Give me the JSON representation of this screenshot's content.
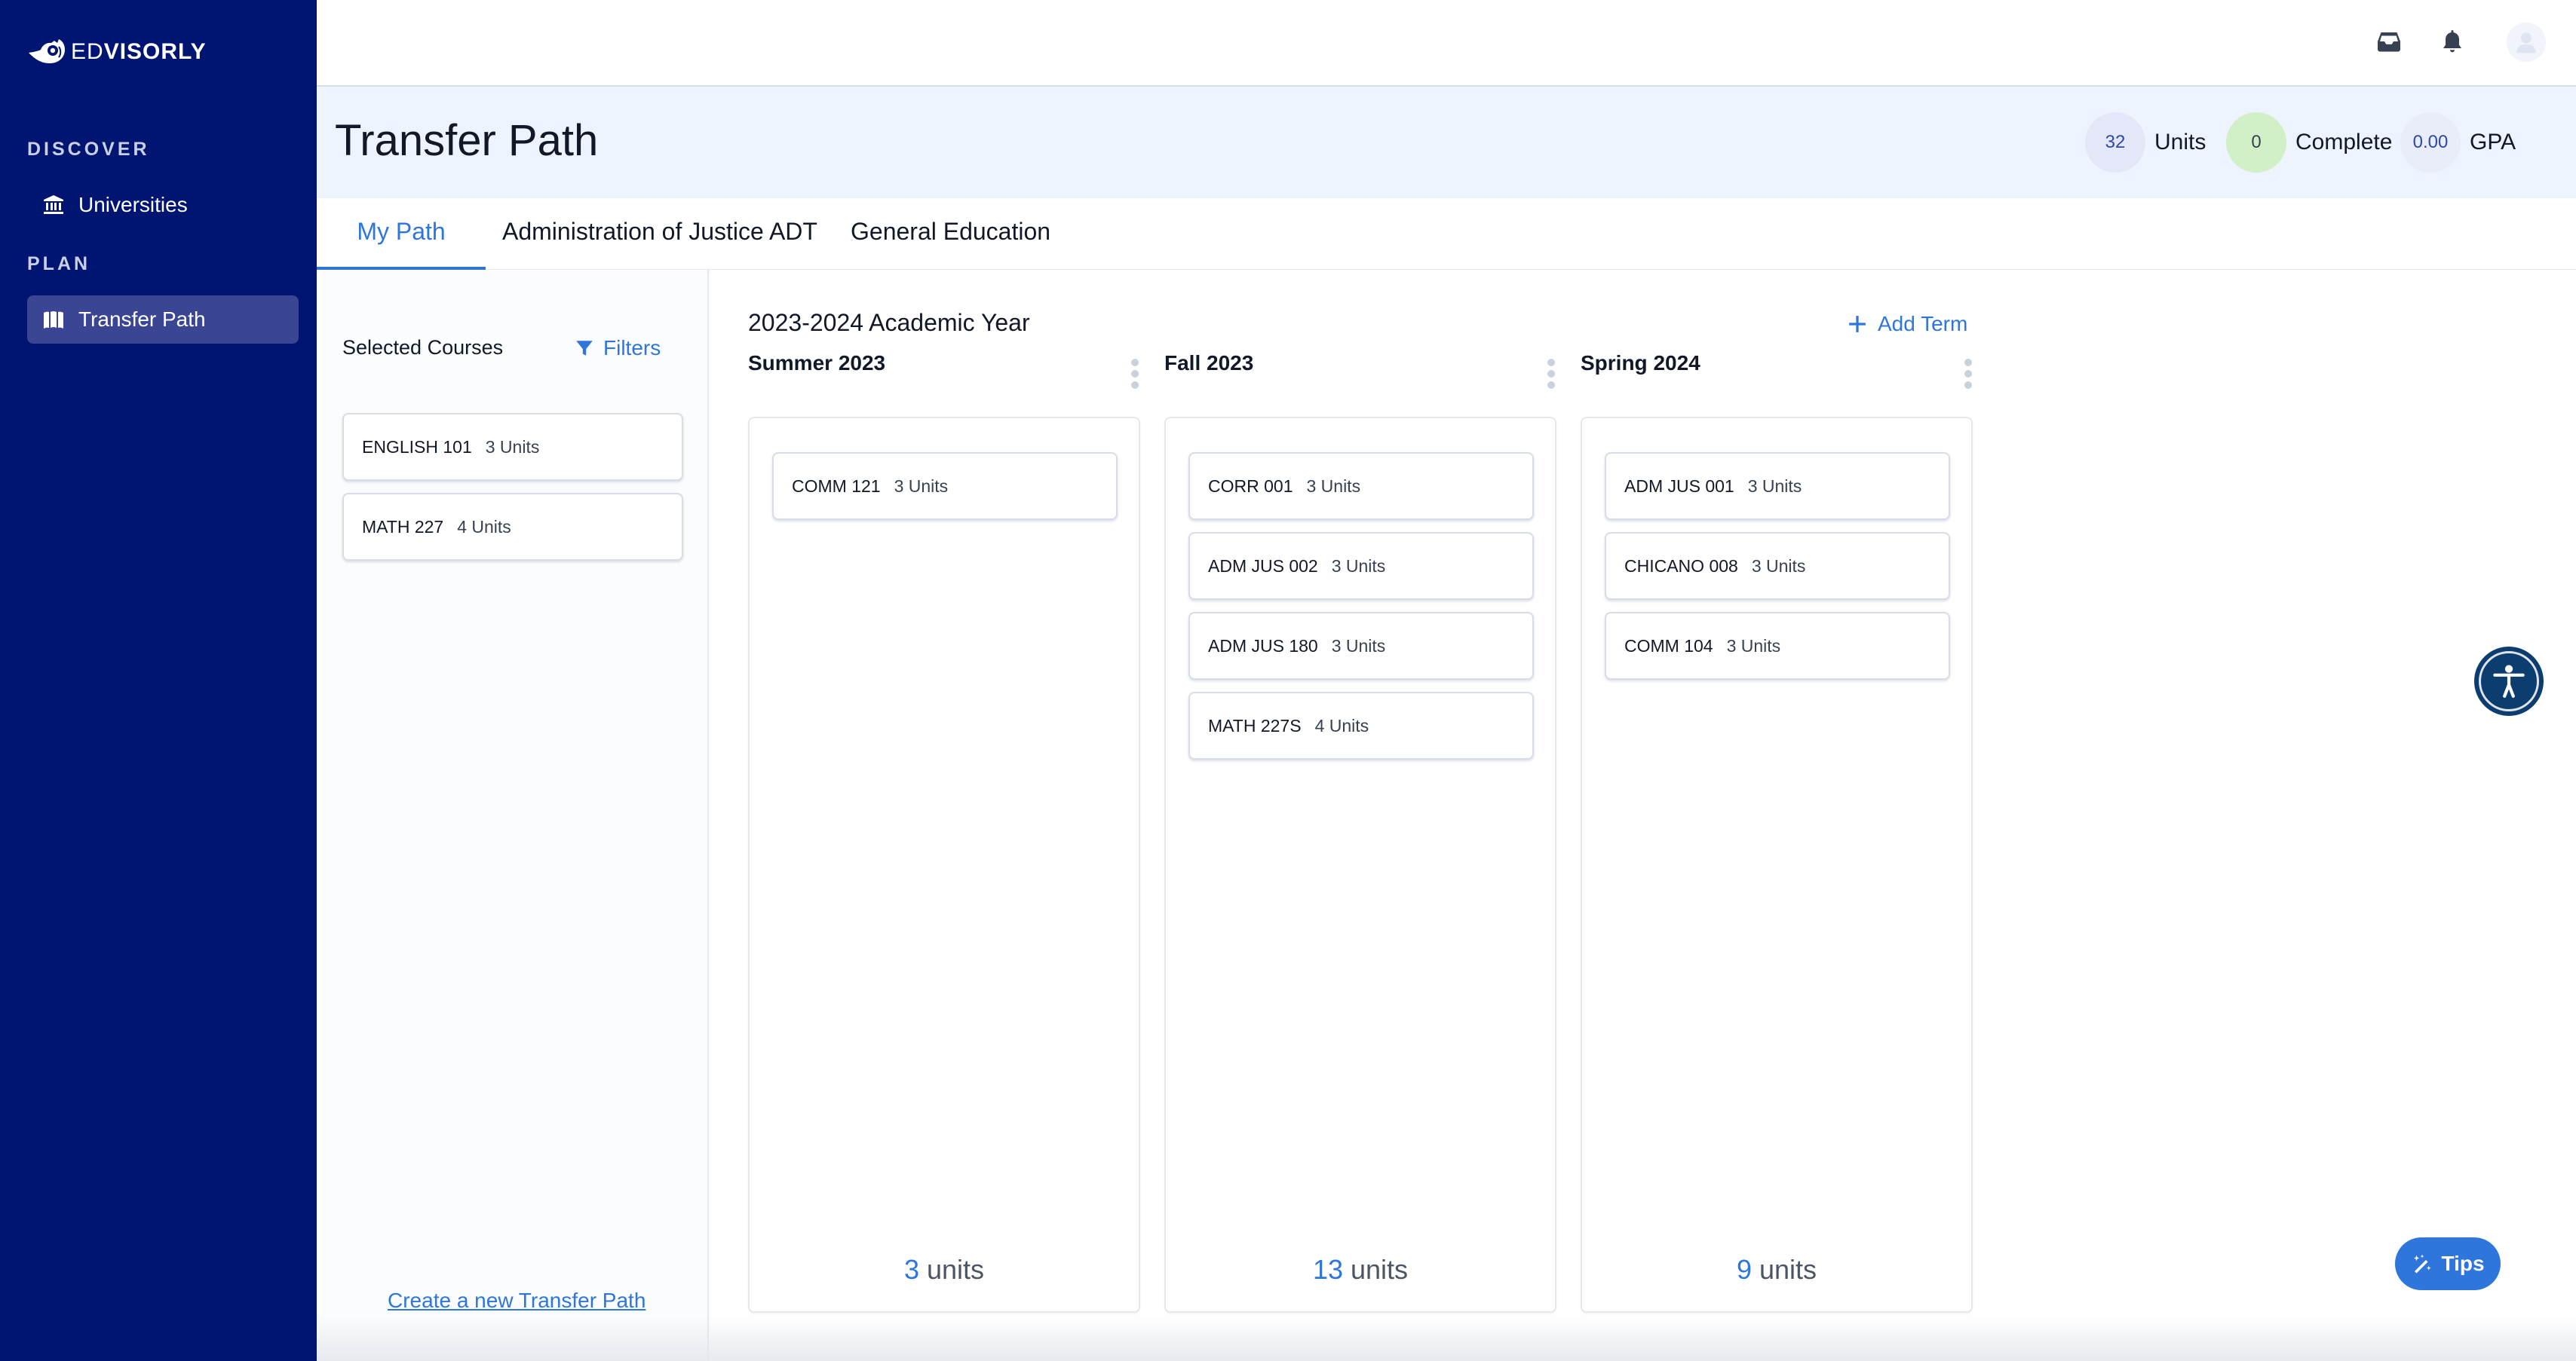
{
  "app": {
    "brand_ed": "ED",
    "brand_visorly": "VISORLY"
  },
  "sidebar": {
    "sections": [
      {
        "label": "DISCOVER",
        "items": [
          {
            "label": "Universities",
            "icon": "university-icon",
            "active": false
          }
        ]
      },
      {
        "label": "PLAN",
        "items": [
          {
            "label": "Transfer Path",
            "icon": "map-icon",
            "active": true
          }
        ]
      }
    ]
  },
  "topbar": {
    "icons": [
      "inbox-icon",
      "bell-icon",
      "user-avatar-icon"
    ]
  },
  "header": {
    "title": "Transfer Path",
    "stats": [
      {
        "value": "32",
        "label": "Units"
      },
      {
        "value": "0",
        "label": "Complete"
      },
      {
        "value": "0.00",
        "label": "GPA"
      }
    ]
  },
  "tabs": [
    {
      "label": "My Path",
      "active": true
    },
    {
      "label": "Administration of Justice ADT",
      "active": false
    },
    {
      "label": "General Education",
      "active": false
    }
  ],
  "left_panel": {
    "title": "Selected Courses",
    "filters_label": "Filters",
    "courses": [
      {
        "code": "ENGLISH 101",
        "units": "3 Units"
      },
      {
        "code": "MATH 227",
        "units": "4 Units"
      }
    ],
    "create_link": "Create a new Transfer Path"
  },
  "board": {
    "year_title": "2023-2024 Academic Year",
    "add_term_label": "Add Term",
    "terms": [
      {
        "name": "Summer 2023",
        "courses": [
          {
            "code": "COMM 121",
            "units": "3 Units"
          }
        ],
        "total_num": "3",
        "total_label": "units"
      },
      {
        "name": "Fall 2023",
        "courses": [
          {
            "code": "CORR 001",
            "units": "3 Units"
          },
          {
            "code": "ADM JUS 002",
            "units": "3 Units"
          },
          {
            "code": "ADM JUS 180",
            "units": "3 Units"
          },
          {
            "code": "MATH 227S",
            "units": "4 Units"
          }
        ],
        "total_num": "13",
        "total_label": "units"
      },
      {
        "name": "Spring 2024",
        "courses": [
          {
            "code": "ADM JUS 001",
            "units": "3 Units"
          },
          {
            "code": "CHICANO 008",
            "units": "3 Units"
          },
          {
            "code": "COMM 104",
            "units": "3 Units"
          }
        ],
        "total_num": "9",
        "total_label": "units"
      }
    ]
  },
  "floating": {
    "tips_label": "Tips",
    "accessibility_icon": "accessibility-icon"
  },
  "colors": {
    "sidebar_bg": "#001571",
    "accent": "#2f76dc",
    "title_band_bg": "#edf4fd",
    "complete_badge_bg": "#d2f0c7"
  }
}
